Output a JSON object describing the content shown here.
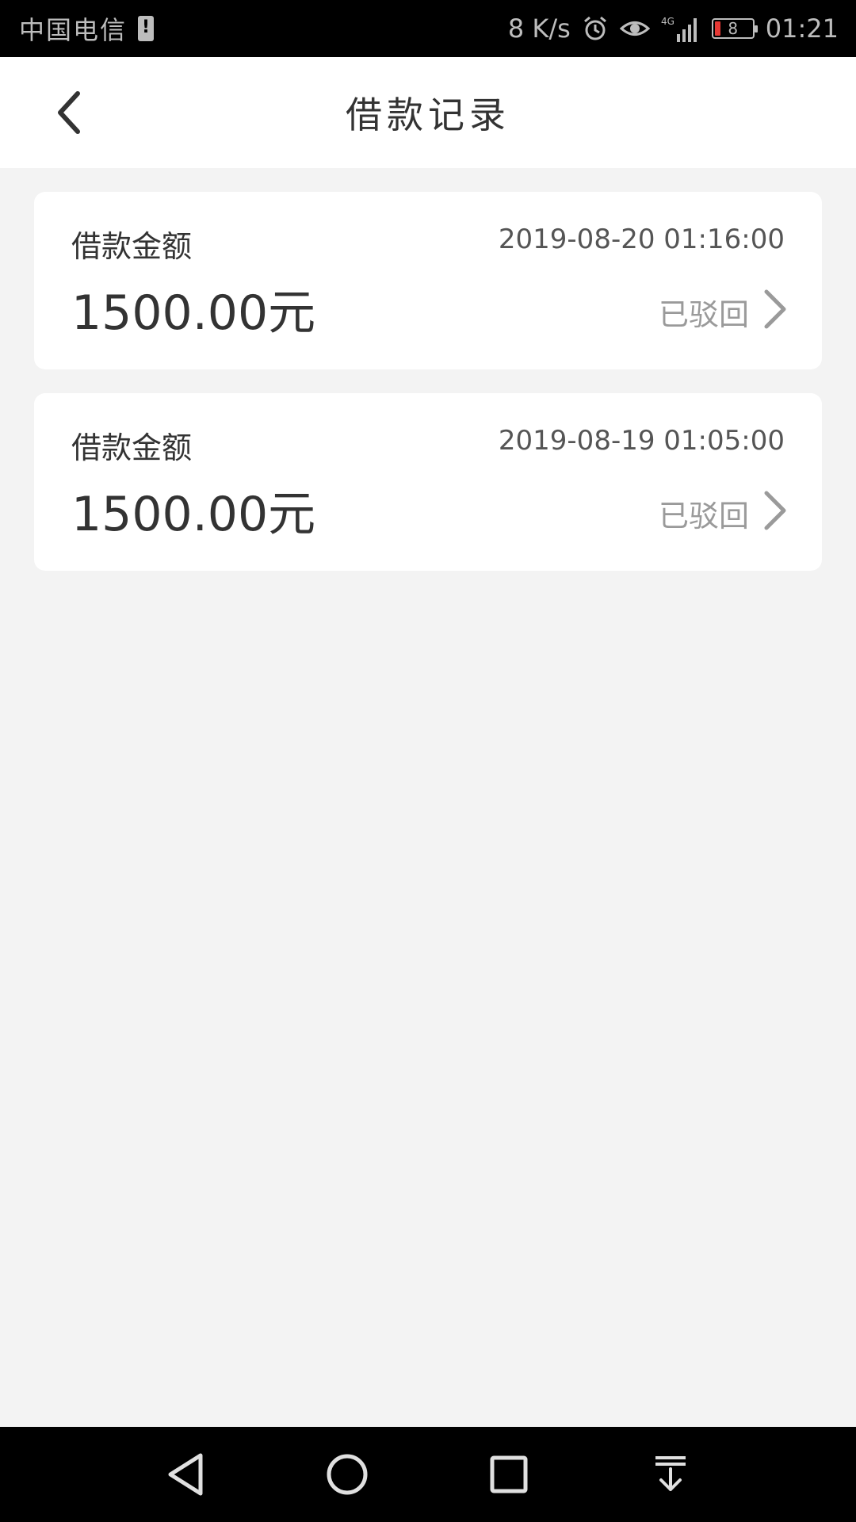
{
  "status_bar": {
    "carrier": "中国电信",
    "net_speed": "8 K/s",
    "network": "4G",
    "battery_level": "8",
    "time": "01:21"
  },
  "header": {
    "title": "借款记录"
  },
  "records": [
    {
      "label": "借款金额",
      "amount": "1500.00元",
      "time": "2019-08-20 01:16:00",
      "status": "已驳回"
    },
    {
      "label": "借款金额",
      "amount": "1500.00元",
      "time": "2019-08-19 01:05:00",
      "status": "已驳回"
    }
  ],
  "colors": {
    "background": "#f3f3f3",
    "card": "#ffffff",
    "text_primary": "#333333",
    "text_secondary": "#9a9a9a",
    "battery_low": "#e53935"
  }
}
